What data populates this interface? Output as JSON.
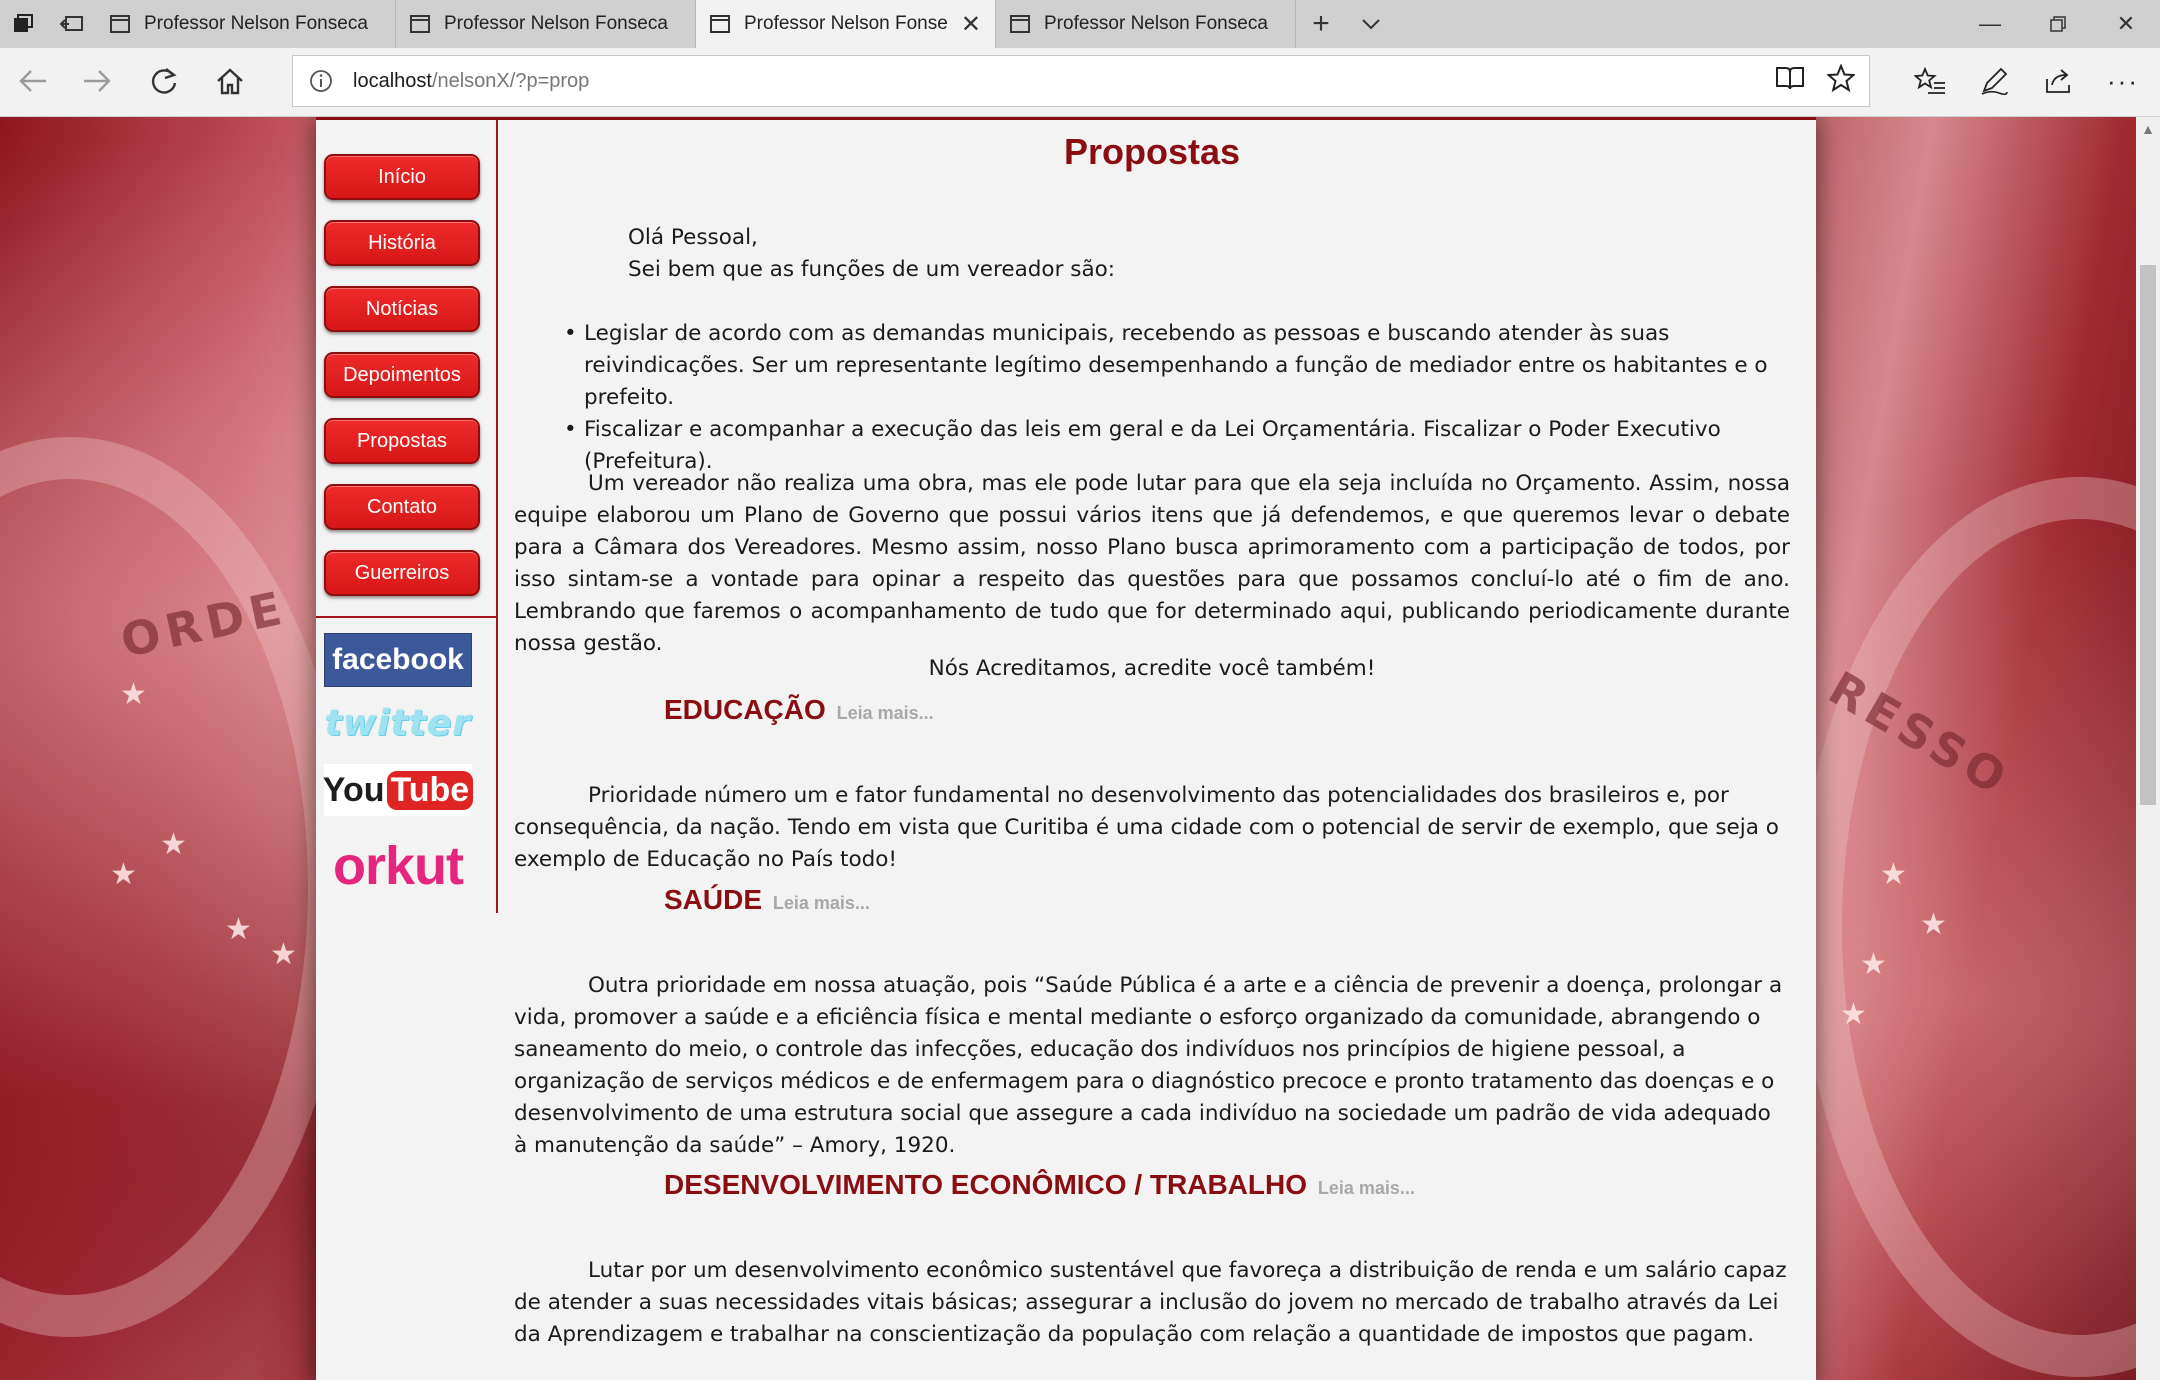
{
  "browser": {
    "tabs": [
      {
        "title": "Professor Nelson Fonseca",
        "active": false
      },
      {
        "title": "Professor Nelson Fonseca",
        "active": false
      },
      {
        "title": "Professor Nelson Fonse",
        "active": true
      },
      {
        "title": "Professor Nelson Fonseca",
        "active": false
      }
    ],
    "url_host": "localhost",
    "url_path": "/nelsonX/?p=prop"
  },
  "sidebar": {
    "menu": [
      "Início",
      "História",
      "Notícias",
      "Depoimentos",
      "Propostas",
      "Contato",
      "Guerreiros"
    ],
    "social": {
      "facebook": "facebook",
      "twitter": "twitter",
      "youtube_you": "You",
      "youtube_tube": "Tube",
      "orkut": "orkut"
    }
  },
  "content": {
    "title": "Propostas",
    "greeting_1": "Olá Pessoal,",
    "greeting_2": "Sei bem que as funções de um vereador são:",
    "bullets": [
      "Legislar de acordo com as demandas municipais, recebendo as pessoas e buscando atender às suas reivindicações. Ser um representante legítimo desempenhando a função de mediador entre os habitantes e o prefeito.",
      "Fiscalizar e acompanhar a execução das leis em geral e da Lei Orçamentária. Fiscalizar o Poder Executivo (Prefeitura)."
    ],
    "intro_paragraph": "Um vereador não realiza uma obra, mas ele pode lutar para que ela seja incluída no Orçamento. Assim, nossa equipe elaborou um Plano de Governo que possui vários itens que já defendemos, e que queremos levar o debate para a Câmara dos Vereadores. Mesmo assim, nosso Plano busca aprimoramento com a participação de todos, por isso sintam-se a vontade para opinar a respeito das questões para que possamos concluí-lo até o fim de ano. Lembrando que faremos o acompanhamento de tudo que for determinado aqui, publicando periodicamente durante nossa gestão.",
    "slogan": "Nós Acreditamos, acredite você também!",
    "read_more": "Leia mais...",
    "sections": [
      {
        "title": "EDUCAÇÃO",
        "text": "Prioridade número um e fator fundamental no desenvolvimento das potencialidades dos brasileiros e, por consequência, da nação. Tendo em vista que Curitiba é uma cidade com o potencial de servir de exemplo, que seja o exemplo de Educação no País todo!"
      },
      {
        "title": "SAÚDE",
        "text": "Outra prioridade em nossa atuação, pois “Saúde Pública é a arte e a ciência de prevenir a doença, prolongar a vida, promover a saúde e a eficiência física e mental mediante o esforço organizado da comunidade, abrangendo o saneamento do meio, o controle das infecções, educação dos indivíduos nos princípios de higiene pessoal, a organização de serviços médicos e de enfermagem para o diagnóstico precoce e pronto tratamento das doenças e o desenvolvimento de uma estrutura social que assegure a cada indivíduo na sociedade um padrão de vida adequado à manutenção da saúde” – Amory, 1920."
      },
      {
        "title": "DESENVOLVIMENTO ECONÔMICO / TRABALHO",
        "text": "Lutar por um desenvolvimento econômico sustentável que favoreça a distribuição de renda e um salário capaz de atender a suas necessidades vitais básicas; assegurar a inclusão do jovem no mercado de trabalho através da Lei da Aprendizagem e trabalhar na conscientização da população com relação a quantidade de impostos que pagam."
      }
    ]
  },
  "background": {
    "flag_word_left": "ORDE",
    "flag_word_right": "RESSO"
  },
  "colors": {
    "accent": "#8a0d12",
    "button": "#e02020",
    "read_more": "#a8a8a8"
  }
}
